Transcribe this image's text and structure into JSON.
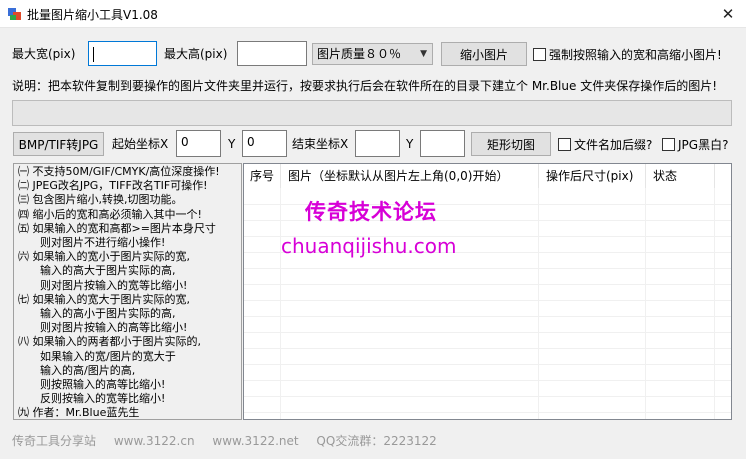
{
  "window": {
    "title": "批量图片缩小工具V1.08",
    "close_glyph": "✕"
  },
  "row1": {
    "max_width_label": "最大宽(pix)",
    "max_width_value": "",
    "max_height_label": "最大高(pix)",
    "max_height_value": "",
    "quality_select": "图片质量８０％",
    "shrink_button": "缩小图片",
    "force_checkbox_label": "强制按照输入的宽和高缩小图片!"
  },
  "instructions": "说明：把本软件复制到要操作的图片文件夹里并运行，按要求执行后会在软件所在的目录下建立个 Mr.Blue 文件夹保存操作后的图片!",
  "progress": {
    "value": 0
  },
  "row3": {
    "convert_button": "BMP/TIF转JPG",
    "start_label": "起始坐标X",
    "start_x": "0",
    "y_label_1": "Y",
    "start_y": "0",
    "end_label": "结束坐标X",
    "end_x": "",
    "y_label_2": "Y",
    "end_y": "",
    "crop_button": "矩形切图",
    "suffix_checkbox_label": "文件名加后缀?",
    "bw_checkbox_label": "JPG黑白?"
  },
  "notes": [
    "㈠ 不支持50M/GIF/CMYK/高位深度操作!",
    "㈡ JPEG改名JPG，TIFF改名TIF可操作!",
    "㈢ 包含图片缩小,转换,切图功能。",
    "㈣ 缩小后的宽和高必须输入其中一个!",
    "㈤ 如果输入的宽和高都>=图片本身尺寸",
    "　　则对图片不进行缩小操作!",
    "㈥ 如果输入的宽小于图片实际的宽,",
    "　　输入的高大于图片实际的高,",
    "　　则对图片按输入的宽等比缩小!",
    "㈦ 如果输入的宽大于图片实际的宽,",
    "　　输入的高小于图片实际的高,",
    "　　则对图片按输入的高等比缩小!",
    "㈧ 如果输入的两者都小于图片实际的,",
    "　　如果输入的宽/图片的宽大于",
    "　　输入的高/图片的高,",
    "　　则按照输入的高等比缩小!",
    "　　反则按输入的宽等比缩小!",
    "㈨ 作者：Mr.Blue蓝先生"
  ],
  "list": {
    "columns": [
      "序号",
      "图片（坐标默认从图片左上角(0,0)开始）",
      "操作后尺寸(pix)",
      "状态"
    ]
  },
  "watermark": {
    "line1": "传奇技术论坛",
    "line2": "chuanqijishu.com"
  },
  "footer": [
    "传奇工具分享站",
    "www.3122.cn",
    "www.3122.net",
    "QQ交流群：2223122"
  ]
}
